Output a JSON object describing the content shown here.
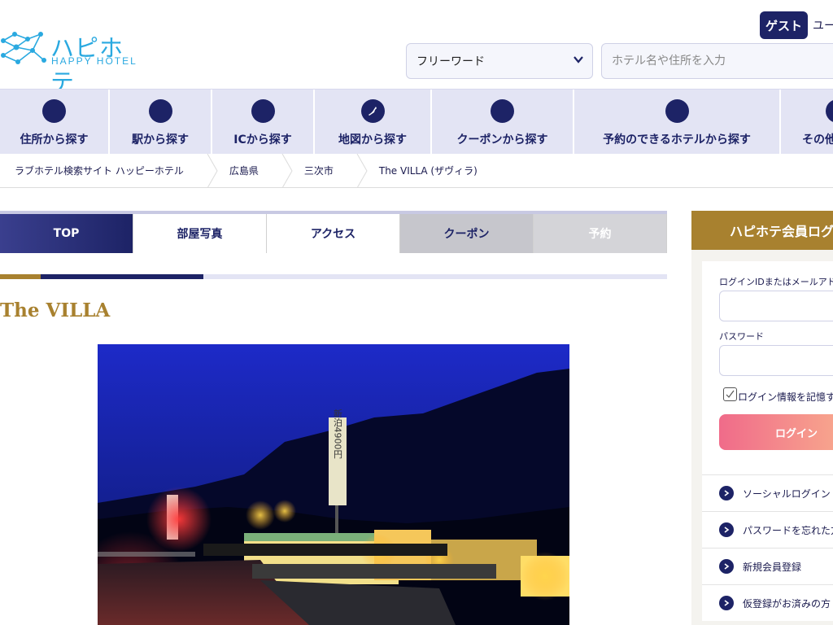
{
  "header": {
    "logo_text": "ハピホテ",
    "logo_sub": "HAPPY HOTEL",
    "guest_label": "ゲスト",
    "user_text": "ユー",
    "search_type": "フリーワード",
    "search_placeholder": "ホテル名や住所を入力"
  },
  "nav": {
    "items": [
      {
        "label": "住所から探す"
      },
      {
        "label": "駅から探す"
      },
      {
        "label": "ICから探す"
      },
      {
        "label": "地図から探す"
      },
      {
        "label": "クーポンから探す"
      },
      {
        "label": "予約のできるホテルから探す"
      },
      {
        "label": "その他"
      }
    ]
  },
  "breadcrumb": [
    "ラブホテル検索サイト ハッピーホテル",
    "広島県",
    "三次市",
    "The VILLA (ザヴィラ)"
  ],
  "tabs": [
    "TOP",
    "部屋写真",
    "アクセス",
    "クーポン",
    "予約"
  ],
  "progress": {
    "segment1": 0.061,
    "segment2": 0.244
  },
  "hotel": {
    "title": "The VILLA",
    "sign_text": "新泊4900円"
  },
  "login": {
    "heading": "ハピホテ会員ログ",
    "id_label": "ログインIDまたはメールアドレ",
    "password_label": "パスワード",
    "remember_label": "ログイン情報を記憶す",
    "login_button": "ログイン",
    "links": [
      "ソーシャルログイン",
      "パスワードを忘れた方",
      "新規会員登録",
      "仮登録がお済みの方"
    ]
  }
}
